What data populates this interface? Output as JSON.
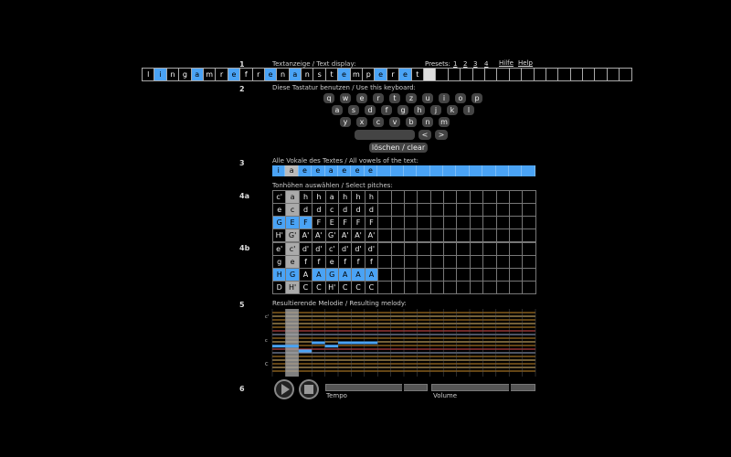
{
  "sections": {
    "s1": "1",
    "s2": "2",
    "s3": "3",
    "s4a": "4a",
    "s4b": "4b",
    "s5": "5",
    "s6": "6"
  },
  "text_display": {
    "label": "Textanzeige / Text display:",
    "cells": [
      {
        "ch": "l",
        "v": false
      },
      {
        "ch": "i",
        "v": true
      },
      {
        "ch": "n",
        "v": false
      },
      {
        "ch": "g",
        "v": false
      },
      {
        "ch": "a",
        "v": true
      },
      {
        "ch": "m",
        "v": false
      },
      {
        "ch": "r",
        "v": false
      },
      {
        "ch": "e",
        "v": true
      },
      {
        "ch": "f",
        "v": false
      },
      {
        "ch": "r",
        "v": false
      },
      {
        "ch": "e",
        "v": true
      },
      {
        "ch": "n",
        "v": false
      },
      {
        "ch": "a",
        "v": true
      },
      {
        "ch": "n",
        "v": false
      },
      {
        "ch": "s",
        "v": false
      },
      {
        "ch": "t",
        "v": false
      },
      {
        "ch": "e",
        "v": true
      },
      {
        "ch": "m",
        "v": false
      },
      {
        "ch": "p",
        "v": false
      },
      {
        "ch": "e",
        "v": true
      },
      {
        "ch": "r",
        "v": false
      },
      {
        "ch": "e",
        "v": true
      },
      {
        "ch": "t",
        "v": false
      },
      {
        "ch": "",
        "v": false,
        "cur": true
      },
      {
        "ch": "",
        "v": false
      },
      {
        "ch": "",
        "v": false
      },
      {
        "ch": "",
        "v": false
      },
      {
        "ch": "",
        "v": false
      },
      {
        "ch": "",
        "v": false
      },
      {
        "ch": "",
        "v": false
      },
      {
        "ch": "",
        "v": false
      },
      {
        "ch": "",
        "v": false
      },
      {
        "ch": "",
        "v": false
      },
      {
        "ch": "",
        "v": false
      },
      {
        "ch": "",
        "v": false
      },
      {
        "ch": "",
        "v": false
      },
      {
        "ch": "",
        "v": false
      },
      {
        "ch": "",
        "v": false
      },
      {
        "ch": "",
        "v": false
      },
      {
        "ch": "",
        "v": false
      }
    ]
  },
  "presets": {
    "label": "Presets:",
    "items": [
      "1",
      "2",
      "3",
      "4"
    ],
    "hilfe": "Hilfe",
    "help": "Help"
  },
  "keyboard": {
    "label": "Diese Tastatur benutzen / Use this keyboard:",
    "row1": [
      "q",
      "w",
      "e",
      "r",
      "t",
      "z",
      "u",
      "i",
      "o",
      "p"
    ],
    "row2": [
      "a",
      "s",
      "d",
      "f",
      "g",
      "h",
      "j",
      "k",
      "l"
    ],
    "row3": [
      "y",
      "x",
      "c",
      "v",
      "b",
      "n",
      "m"
    ],
    "left": "<",
    "right": ">",
    "clear": "löschen / clear"
  },
  "vowels": {
    "label": "Alle Vokale des Textes / All vowels of the text:",
    "cells": [
      "i",
      "a",
      "e",
      "e",
      "a",
      "e",
      "e",
      "e",
      "",
      "",
      "",
      "",
      "",
      "",
      "",
      "",
      "",
      "",
      "",
      ""
    ],
    "selected_index": 1
  },
  "pitches": {
    "label": "Tonhöhen auswählen / Select pitches:",
    "grid_a": [
      [
        "c'",
        "a",
        "h",
        "h",
        "a",
        "h",
        "h",
        "h"
      ],
      [
        "e",
        "c",
        "d",
        "d",
        "c",
        "d",
        "d",
        "d"
      ],
      [
        "G",
        "E",
        "F",
        "F",
        "E",
        "F",
        "F",
        "F"
      ],
      [
        "H'",
        "G'",
        "A'",
        "A'",
        "G'",
        "A'",
        "A'",
        "A'"
      ]
    ],
    "grid_b": [
      [
        "e'",
        "c'",
        "d'",
        "d'",
        "c'",
        "d'",
        "d'",
        "d'"
      ],
      [
        "g",
        "e",
        "f",
        "f",
        "e",
        "f",
        "f",
        "f"
      ],
      [
        "H",
        "G",
        "A",
        "A",
        "G",
        "A",
        "A",
        "A"
      ],
      [
        "D",
        "H'",
        "C",
        "C",
        "H'",
        "C",
        "C",
        "C"
      ]
    ],
    "highlight_a": [
      [
        2,
        0
      ],
      [
        2,
        1
      ],
      [
        2,
        2
      ]
    ],
    "highlight_b": [
      [
        2,
        0
      ],
      [
        2,
        1
      ],
      [
        2,
        3
      ],
      [
        2,
        4
      ],
      [
        2,
        5
      ],
      [
        2,
        6
      ],
      [
        2,
        7
      ]
    ],
    "gray_column": 1,
    "columns": 20
  },
  "melody": {
    "label": "Resultierende Melodie / Resulting melody:",
    "clef_labels": [
      "c'",
      "c",
      "C"
    ],
    "line_colors": [
      "#c98a2a",
      "#e8c070",
      "#e05050",
      "#9aa8c8"
    ],
    "notes": [
      0.55,
      0.55,
      0.62,
      0.5,
      0.55,
      0.5,
      0.5,
      0.5
    ],
    "note_color": "#4aa3f5"
  },
  "transport": {
    "tempo_label": "Tempo",
    "volume_label": "Volume",
    "tempo_value": 0.75,
    "volume_value": 0.75
  }
}
